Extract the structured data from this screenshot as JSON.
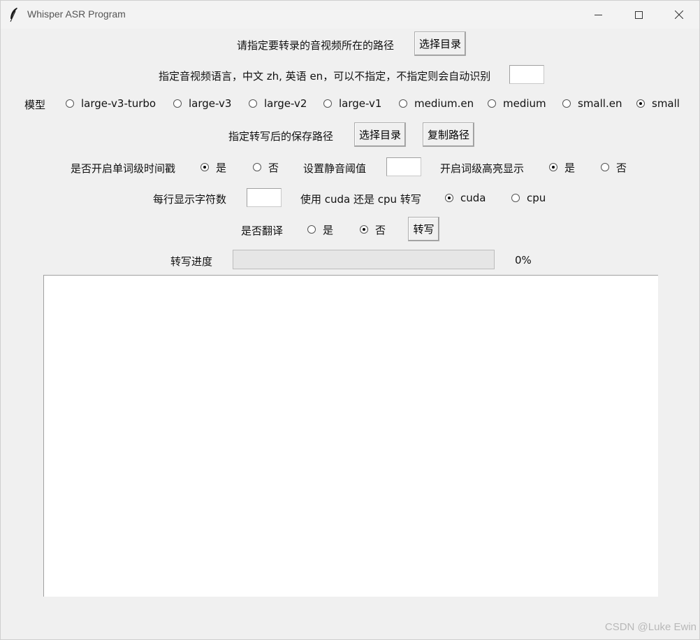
{
  "window": {
    "title": "Whisper ASR Program"
  },
  "row1": {
    "label": "请指定要转录的音视频所在的路径",
    "button": "选择目录"
  },
  "row2": {
    "label": "指定音视频语言，中文 zh, 英语 en，可以不指定，不指定则会自动识别",
    "input_value": ""
  },
  "model": {
    "label": "模型",
    "options": [
      "large-v3-turbo",
      "large-v3",
      "large-v2",
      "large-v1",
      "medium.en",
      "medium",
      "small.en",
      "small"
    ],
    "selected": "small"
  },
  "row4": {
    "label": "指定转写后的保存路径",
    "select_button": "选择目录",
    "copy_button": "复制路径"
  },
  "row5": {
    "word_ts_label": "是否开启单词级时间戳",
    "word_ts_options": [
      "是",
      "否"
    ],
    "word_ts_selected": "是",
    "silence_label": "设置静音阈值",
    "silence_value": "",
    "highlight_label": "开启词级高亮显示",
    "highlight_options": [
      "是",
      "否"
    ],
    "highlight_selected": "是"
  },
  "row6": {
    "chars_label": "每行显示字符数",
    "chars_value": "",
    "device_label": "使用 cuda 还是 cpu 转写",
    "device_options": [
      "cuda",
      "cpu"
    ],
    "device_selected": "cuda"
  },
  "row7": {
    "translate_label": "是否翻译",
    "translate_options": [
      "是",
      "否"
    ],
    "translate_selected": "否",
    "transcribe_button": "转写"
  },
  "progress": {
    "label": "转写进度",
    "percent_text": "0%",
    "value": 0
  },
  "output_text": "",
  "watermark": "CSDN @Luke Ewin"
}
